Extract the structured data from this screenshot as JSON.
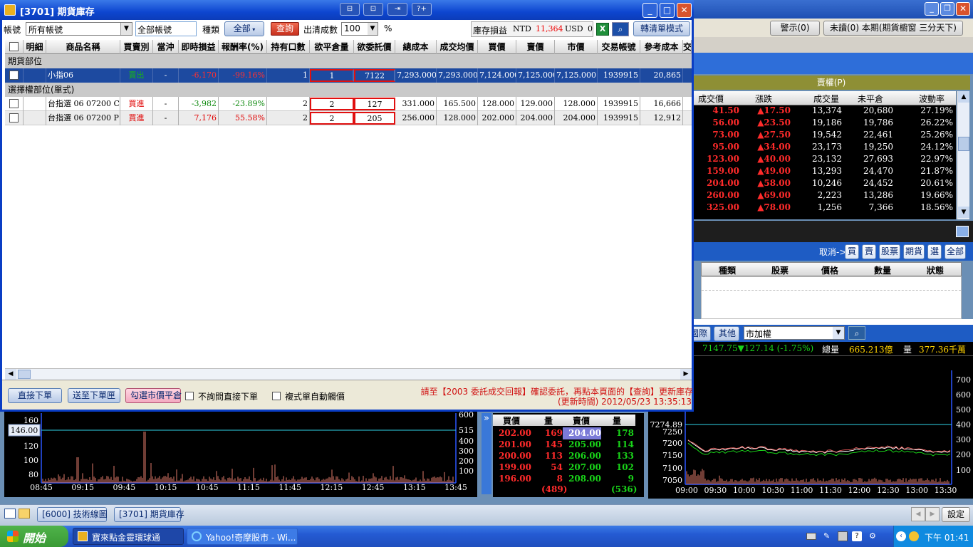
{
  "window": {
    "title": "[3701] 期貨庫存"
  },
  "toolbar": {
    "account_label": "帳號",
    "account_value": "所有帳號",
    "account2_value": "全部帳號",
    "type_label": "種類",
    "type_value": "全部",
    "query_label": "查詢",
    "clear_label": "出清成數",
    "clear_value": "100",
    "pct": "%",
    "pnl_label": "庫存損益",
    "ntd_label": "NTD",
    "ntd_value": "11,364",
    "usd_label": "USD",
    "usd_value": "0",
    "switch_label": "轉清單模式"
  },
  "table": {
    "headers": [
      "明細",
      "商品名稱",
      "買賣別",
      "當沖",
      "即時損益",
      "報酬率(%)",
      "持有口數",
      "欲平倉量",
      "欲委託價",
      "總成本",
      "成交均價",
      "買價",
      "賣價",
      "市價",
      "交易帳號",
      "參考成本",
      "交"
    ],
    "section1": "期貨部位",
    "fut_row": [
      "小指06",
      "賣出",
      "-",
      "-6,170",
      "-99.16%",
      "1",
      "1",
      "7122",
      "7,293.000",
      "7,293.000",
      "7,124.000",
      "7,125.000",
      "7,125.000",
      "1939915",
      "20,865"
    ],
    "section2": "選擇權部位(單式)",
    "opt_rows": [
      [
        "台指選 06 07200 C",
        "買進",
        "-",
        "-3,982",
        "-23.89%",
        "2",
        "2",
        "127",
        "331.000",
        "165.500",
        "128.000",
        "129.000",
        "128.000",
        "1939915",
        "16,666"
      ],
      [
        "台指選 06 07200 P",
        "買進",
        "-",
        "7,176",
        "55.58%",
        "2",
        "2",
        "205",
        "256.000",
        "128.000",
        "202.000",
        "204.000",
        "204.000",
        "1939915",
        "12,912"
      ]
    ]
  },
  "bottom": {
    "direct_order": "直接下單",
    "send_order": "送至下單匣",
    "mkt_close": "勾選市價平倉",
    "no_ask": "不詢問直接下單",
    "auto_tick": "複式單自動觸價",
    "notice": "請至【2003 委託成交回報】確認委託，再點本頁面的【查詢】更新庫存",
    "update_time": "(更新時間) 2012/05/23 13:35:13"
  },
  "right": {
    "warn": "警示(0)",
    "unread": "未讀(0) 本期(期貨櫥窗 三分天下)",
    "put_title": "賣權(P)",
    "put_headers": [
      "成交價",
      "漲跌",
      "成交量",
      "未平倉",
      "波動率"
    ],
    "put_rows": [
      [
        "41.50",
        "▲17.50",
        "13,374",
        "20,680",
        "27.19%"
      ],
      [
        "56.00",
        "▲23.50",
        "19,186",
        "19,786",
        "26.22%"
      ],
      [
        "73.00",
        "▲27.50",
        "19,542",
        "22,461",
        "25.26%"
      ],
      [
        "95.00",
        "▲34.00",
        "23,173",
        "19,250",
        "24.12%"
      ],
      [
        "123.00",
        "▲40.00",
        "23,132",
        "27,693",
        "22.97%"
      ],
      [
        "159.00",
        "▲49.00",
        "13,293",
        "24,470",
        "21.87%"
      ],
      [
        "204.00",
        "▲58.00",
        "10,246",
        "24,452",
        "20.61%"
      ],
      [
        "260.00",
        "▲69.00",
        "2,223",
        "13,286",
        "19.66%"
      ],
      [
        "325.00",
        "▲78.00",
        "1,256",
        "7,366",
        "18.56%"
      ]
    ],
    "cancel_label": "取消->",
    "cancel_btns": [
      "買",
      "賣",
      "股票",
      "期貨",
      "選",
      "全部"
    ],
    "order_headers": [
      "種類",
      "股票",
      "價格",
      "數量",
      "狀態"
    ],
    "intl": "國際",
    "other": "其他",
    "market": "市加權",
    "idx_value": "7147.75▼127.14 (-1.75%)",
    "vol_label": "總量",
    "vol_value": "665.213億",
    "qty_label": "量",
    "qty_value": "377.36千萬"
  },
  "chart_left": {
    "y_labels": [
      "160",
      "146.00",
      "120",
      "100",
      "80"
    ],
    "y2_labels": [
      "600",
      "515",
      "400",
      "300",
      "200",
      "100"
    ],
    "x_labels": [
      "08:45",
      "09:15",
      "09:45",
      "10:15",
      "10:45",
      "11:15",
      "11:45",
      "12:15",
      "12:45",
      "13:15",
      "13:45"
    ]
  },
  "quote": {
    "headers": [
      "買價",
      "量",
      "賣價",
      "量"
    ],
    "rows": [
      [
        "202.00",
        "169",
        "204.00",
        "178"
      ],
      [
        "201.00",
        "145",
        "205.00",
        "114"
      ],
      [
        "200.00",
        "113",
        "206.00",
        "133"
      ],
      [
        "199.00",
        "54",
        "207.00",
        "102"
      ],
      [
        "196.00",
        "8",
        "208.00",
        "9"
      ]
    ],
    "bid_total": "(489)",
    "ask_total": "(536)"
  },
  "chart_right": {
    "y_labels": [
      "7274.89",
      "7250",
      "7200",
      "7150",
      "7100",
      "7050"
    ],
    "y2_labels": [
      "700",
      "600",
      "500",
      "400",
      "300",
      "200",
      "100"
    ],
    "x_labels": [
      "09:00",
      "09:30",
      "10:00",
      "10:30",
      "11:00",
      "11:30",
      "12:00",
      "12:30",
      "13:00",
      "13:30"
    ]
  },
  "statusbar": {
    "tab1": "[6000] 技術線圖",
    "tab2": "[3701] 期貨庫存",
    "settings": "設定"
  },
  "taskbar": {
    "start": "開始",
    "task1": "寶來點金靈環球通",
    "task2": "Yahoo!奇摩股市 - Wi...",
    "clock": "下午 01:41"
  }
}
